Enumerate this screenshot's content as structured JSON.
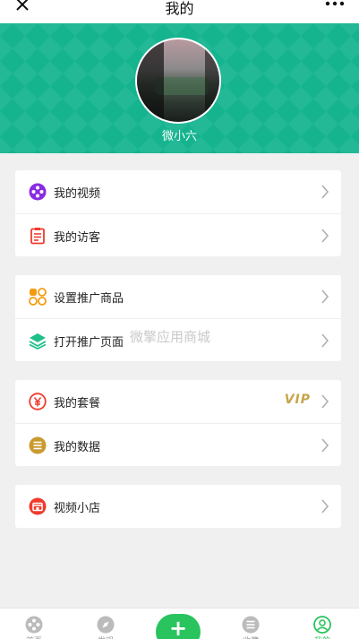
{
  "header": {
    "title": "我的"
  },
  "profile": {
    "username": "微小六"
  },
  "menu_groups": [
    {
      "items": [
        {
          "label": "我的视频",
          "icon": "film-reel-icon",
          "icon_color": "#8a2be2"
        },
        {
          "label": "我的访客",
          "icon": "clipboard-list-icon",
          "icon_color": "#ef3b2d"
        }
      ]
    },
    {
      "items": [
        {
          "label": "设置推广商品",
          "icon": "grid-apps-icon",
          "icon_color": "#f39c12"
        },
        {
          "label": "打开推广页面",
          "icon": "layers-icon",
          "icon_color": "#1fbf8a"
        }
      ]
    },
    {
      "items": [
        {
          "label": "我的套餐",
          "icon": "yuan-coin-icon",
          "icon_color": "#ef3b2d",
          "badge": "VIP"
        },
        {
          "label": "我的数据",
          "icon": "data-list-icon",
          "icon_color": "#c99a2e"
        }
      ]
    },
    {
      "items": [
        {
          "label": "视频小店",
          "icon": "shop-icon",
          "icon_color": "#ef3b2d"
        }
      ]
    }
  ],
  "watermark": "微擎应用商城",
  "tabbar": {
    "labels": [
      "首页",
      "发现",
      "",
      "收藏",
      "我的"
    ],
    "active_color": "#2ac45e",
    "inactive_color": "#999999"
  }
}
